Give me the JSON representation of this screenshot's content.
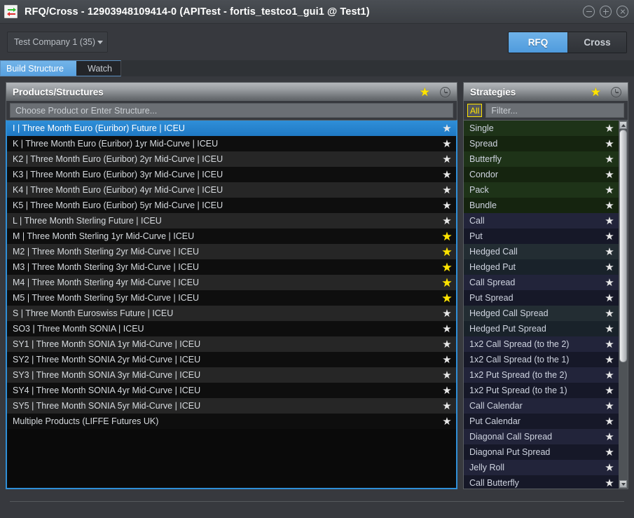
{
  "window": {
    "title": "RFQ/Cross - 12903948109414-0 (APITest - fortis_testco1_gui1 @ Test1)",
    "app_icon": "swap-arrows-icon",
    "controls": {
      "minimize": "minimize-icon",
      "maximize": "maximize-icon",
      "close": "close-icon"
    }
  },
  "toolbar": {
    "company": "Test Company 1 (35)",
    "mode_rfq": "RFQ",
    "mode_cross": "Cross",
    "active_mode": "RFQ",
    "accent_blue": "#4f9bdd"
  },
  "tabs": [
    {
      "label": "Build Structure",
      "active": true
    },
    {
      "label": "Watch",
      "active": false
    }
  ],
  "products": {
    "title": "Products/Structures",
    "search_placeholder": "Choose Product or Enter Structure...",
    "search_value": "",
    "star_icon": "star-icon",
    "clock_icon": "clock-icon",
    "rows": [
      {
        "label": "I | Three Month Euro (Euribor) Future | ICEU",
        "starred": false,
        "selected": true
      },
      {
        "label": "K | Three Month Euro (Euribor) 1yr Mid-Curve | ICEU",
        "starred": false,
        "selected": false
      },
      {
        "label": "K2 | Three Month Euro (Euribor) 2yr Mid-Curve | ICEU",
        "starred": false,
        "selected": false
      },
      {
        "label": "K3 | Three Month Euro (Euribor) 3yr Mid-Curve | ICEU",
        "starred": false,
        "selected": false
      },
      {
        "label": "K4 | Three Month Euro (Euribor) 4yr Mid-Curve | ICEU",
        "starred": false,
        "selected": false
      },
      {
        "label": "K5 | Three Month Euro (Euribor) 5yr Mid-Curve | ICEU",
        "starred": false,
        "selected": false
      },
      {
        "label": "L | Three Month Sterling Future | ICEU",
        "starred": false,
        "selected": false
      },
      {
        "label": "M | Three Month Sterling 1yr Mid-Curve | ICEU",
        "starred": true,
        "selected": false
      },
      {
        "label": "M2 | Three Month Sterling 2yr Mid-Curve | ICEU",
        "starred": true,
        "selected": false
      },
      {
        "label": "M3 | Three Month Sterling 3yr Mid-Curve | ICEU",
        "starred": true,
        "selected": false
      },
      {
        "label": "M4 | Three Month Sterling 4yr Mid-Curve | ICEU",
        "starred": true,
        "selected": false
      },
      {
        "label": "M5 | Three Month Sterling 5yr Mid-Curve | ICEU",
        "starred": true,
        "selected": false
      },
      {
        "label": "S | Three Month Euroswiss Future | ICEU",
        "starred": false,
        "selected": false
      },
      {
        "label": "SO3 | Three Month SONIA | ICEU",
        "starred": false,
        "selected": false
      },
      {
        "label": "SY1 | Three Month SONIA 1yr Mid-Curve | ICEU",
        "starred": false,
        "selected": false
      },
      {
        "label": "SY2 | Three Month SONIA 2yr Mid-Curve | ICEU",
        "starred": false,
        "selected": false
      },
      {
        "label": "SY3 | Three Month SONIA 3yr Mid-Curve | ICEU",
        "starred": false,
        "selected": false
      },
      {
        "label": "SY4 | Three Month SONIA 4yr Mid-Curve | ICEU",
        "starred": false,
        "selected": false
      },
      {
        "label": "SY5 | Three Month SONIA 5yr Mid-Curve | ICEU",
        "starred": false,
        "selected": false
      },
      {
        "label": "Multiple Products (LIFFE Futures UK)",
        "starred": false,
        "selected": false
      }
    ]
  },
  "strategies": {
    "title": "Strategies",
    "filter_badge": "All",
    "filter_placeholder": "Filter...",
    "filter_value": "",
    "star_icon": "star-icon",
    "clock_icon": "clock-icon",
    "rows": [
      {
        "label": "Single",
        "group": "future",
        "starred": false
      },
      {
        "label": "Spread",
        "group": "future",
        "starred": false
      },
      {
        "label": "Butterfly",
        "group": "future",
        "starred": false
      },
      {
        "label": "Condor",
        "group": "future",
        "starred": false
      },
      {
        "label": "Pack",
        "group": "future",
        "starred": false
      },
      {
        "label": "Bundle",
        "group": "future",
        "starred": false
      },
      {
        "label": "Call",
        "group": "option",
        "starred": false
      },
      {
        "label": "Put",
        "group": "option",
        "starred": false
      },
      {
        "label": "Hedged Call",
        "group": "hedged",
        "starred": false
      },
      {
        "label": "Hedged Put",
        "group": "hedged",
        "starred": false
      },
      {
        "label": "Call Spread",
        "group": "option",
        "starred": false
      },
      {
        "label": "Put Spread",
        "group": "option",
        "starred": false
      },
      {
        "label": "Hedged Call Spread",
        "group": "hedged",
        "starred": false
      },
      {
        "label": "Hedged Put Spread",
        "group": "hedged",
        "starred": false
      },
      {
        "label": "1x2 Call Spread (to the 2)",
        "group": "option",
        "starred": false
      },
      {
        "label": "1x2 Call Spread (to the 1)",
        "group": "option",
        "starred": false
      },
      {
        "label": "1x2 Put Spread (to the 2)",
        "group": "option",
        "starred": false
      },
      {
        "label": "1x2 Put Spread (to the 1)",
        "group": "option",
        "starred": false
      },
      {
        "label": "Call Calendar",
        "group": "option",
        "starred": false
      },
      {
        "label": "Put Calendar",
        "group": "option",
        "starred": false
      },
      {
        "label": "Diagonal Call Spread",
        "group": "option",
        "starred": false
      },
      {
        "label": "Diagonal Put Spread",
        "group": "option",
        "starred": false
      },
      {
        "label": "Jelly Roll",
        "group": "option",
        "starred": false
      },
      {
        "label": "Call Butterfly",
        "group": "option",
        "starred": false
      }
    ]
  }
}
